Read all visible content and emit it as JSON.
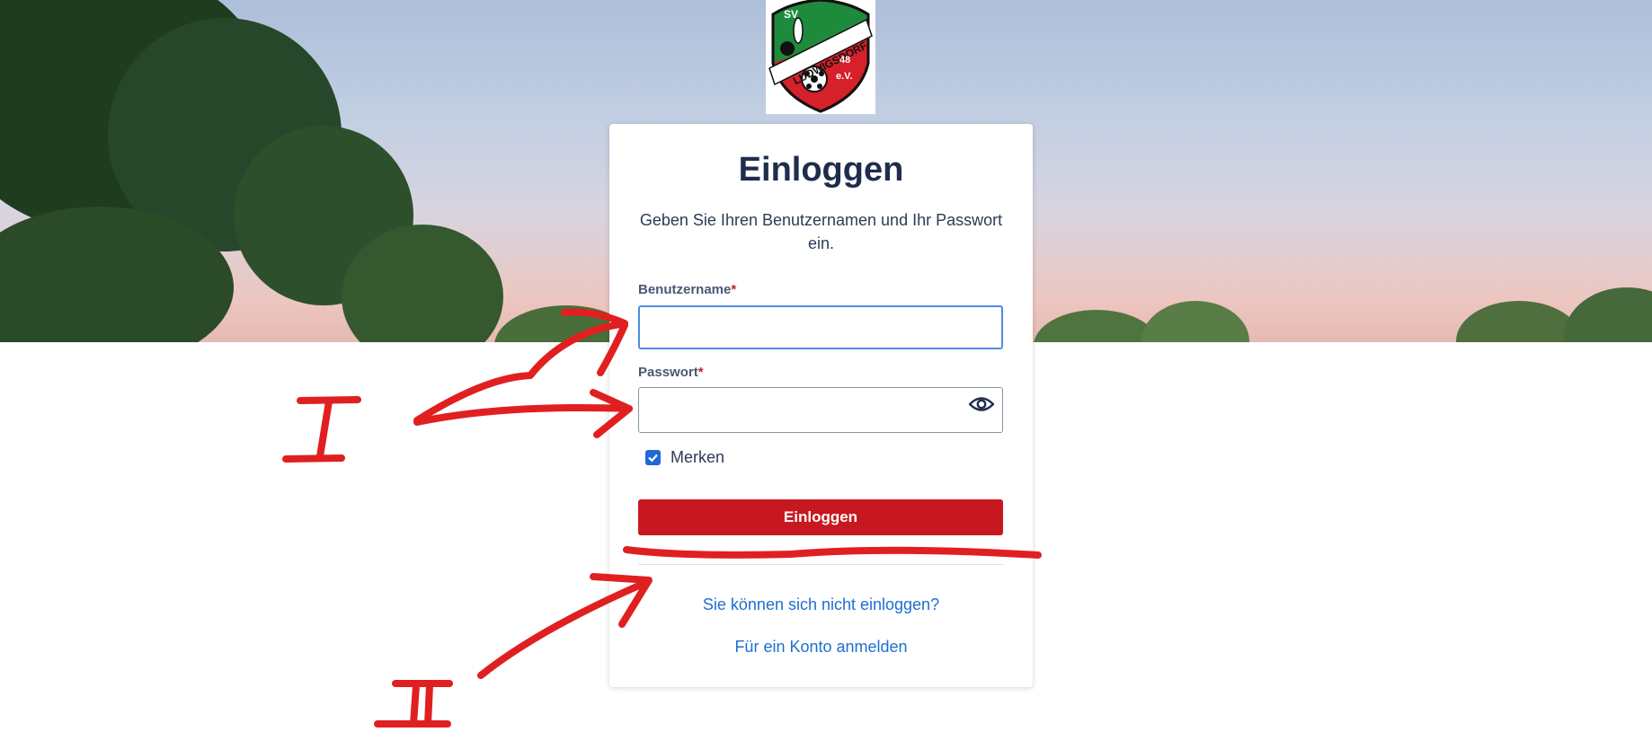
{
  "logo": {
    "text_top": "SV",
    "text_name": "LUDWIGSDORF",
    "text_year": "48",
    "text_suffix": "e.V."
  },
  "card": {
    "title": "Einloggen",
    "description": "Geben Sie Ihren Benutzernamen und Ihr Passwort ein.",
    "username_label": "Benutzername",
    "password_label": "Passwort",
    "required_marker": "*",
    "username_value": "",
    "password_value": "",
    "remember_label": "Merken",
    "remember_checked": true,
    "login_button": "Einloggen",
    "forgot_link": "Sie können sich nicht einloggen?",
    "register_link": "Für ein Konto anmelden"
  },
  "annotations": {
    "mark_1": "I",
    "mark_2": "II",
    "ink_color": "#e02020"
  },
  "colors": {
    "brand_red": "#c8181f",
    "link_blue": "#1d6fd0",
    "focus_blue": "#4c8ee8"
  }
}
